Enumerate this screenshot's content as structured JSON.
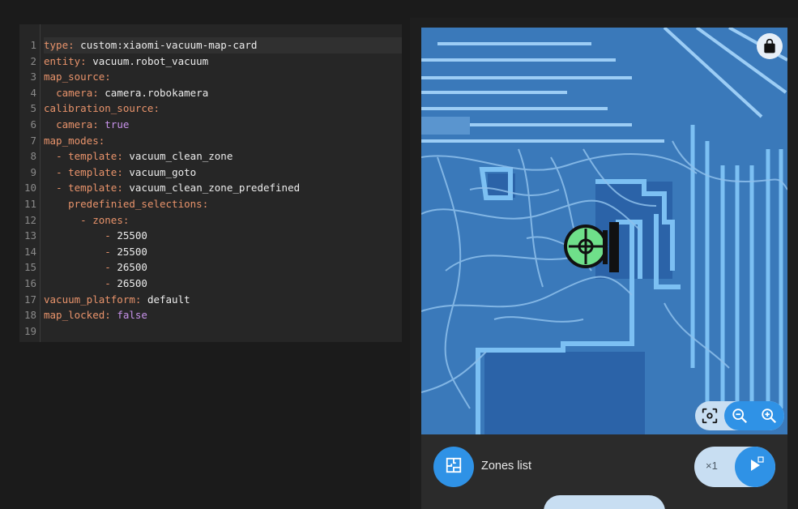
{
  "editor": {
    "line_numbers": [
      "1",
      "2",
      "3",
      "4",
      "5",
      "6",
      "7",
      "8",
      "9",
      "10",
      "11",
      "12",
      "13",
      "14",
      "15",
      "16",
      "17",
      "18",
      "19"
    ],
    "lines": [
      {
        "indent": "",
        "dash": "",
        "key": "type",
        "value": "custom:xiaomi-vacuum-map-card",
        "vtype": "v"
      },
      {
        "indent": "",
        "dash": "",
        "key": "entity",
        "value": "vacuum.robot_vacuum",
        "vtype": "v"
      },
      {
        "indent": "",
        "dash": "",
        "key": "map_source",
        "value": "",
        "vtype": "v"
      },
      {
        "indent": "  ",
        "dash": "",
        "key": "camera",
        "value": "camera.robokamera",
        "vtype": "v"
      },
      {
        "indent": "",
        "dash": "",
        "key": "calibration_source",
        "value": "",
        "vtype": "v"
      },
      {
        "indent": "  ",
        "dash": "",
        "key": "camera",
        "value": "true",
        "vtype": "b"
      },
      {
        "indent": "",
        "dash": "",
        "key": "map_modes",
        "value": "",
        "vtype": "v"
      },
      {
        "indent": "  ",
        "dash": "- ",
        "key": "template",
        "value": "vacuum_clean_zone",
        "vtype": "v"
      },
      {
        "indent": "  ",
        "dash": "- ",
        "key": "template",
        "value": "vacuum_goto",
        "vtype": "v"
      },
      {
        "indent": "  ",
        "dash": "- ",
        "key": "template",
        "value": "vacuum_clean_zone_predefined",
        "vtype": "v"
      },
      {
        "indent": "    ",
        "dash": "",
        "key": "predefinied_selections",
        "value": "",
        "vtype": "v"
      },
      {
        "indent": "      ",
        "dash": "- ",
        "key": "zones",
        "value": "",
        "vtype": "v"
      },
      {
        "indent": "          ",
        "dash": "- ",
        "key": "",
        "value": "25500",
        "vtype": "v"
      },
      {
        "indent": "          ",
        "dash": "- ",
        "key": "",
        "value": "25500",
        "vtype": "v"
      },
      {
        "indent": "          ",
        "dash": "- ",
        "key": "",
        "value": "26500",
        "vtype": "v"
      },
      {
        "indent": "          ",
        "dash": "- ",
        "key": "",
        "value": "26500",
        "vtype": "v"
      },
      {
        "indent": "",
        "dash": "",
        "key": "vacuum_platform",
        "value": "default",
        "vtype": "v"
      },
      {
        "indent": "",
        "dash": "",
        "key": "map_locked",
        "value": "false",
        "vtype": "b"
      },
      {
        "indent": "",
        "dash": "",
        "key": "",
        "value": "",
        "vtype": "v"
      }
    ],
    "active_line": 0
  },
  "card": {
    "map": {
      "lock_icon": "lock-icon",
      "zoom_fit_icon": "fit-to-screen-icon",
      "zoom_out_icon": "magnify-minus-icon",
      "zoom_in_icon": "magnify-plus-icon",
      "robot_icon": "vacuum-robot-icon"
    },
    "controls": {
      "mode_icon": "floor-plan-icon",
      "mode_label": "Zones list",
      "repeats_label": "×1",
      "run_icon": "play-icon"
    }
  },
  "colors": {
    "map_background": "#3a79ba",
    "map_rooms": "#2b6bb0",
    "map_walls": "#7cc0f3",
    "map_paths": "#9ccdf5",
    "accent": "#2f92e6",
    "pill_light": "#c8def2",
    "yaml_key": "#e8936b",
    "yaml_bool": "#c792ea"
  }
}
